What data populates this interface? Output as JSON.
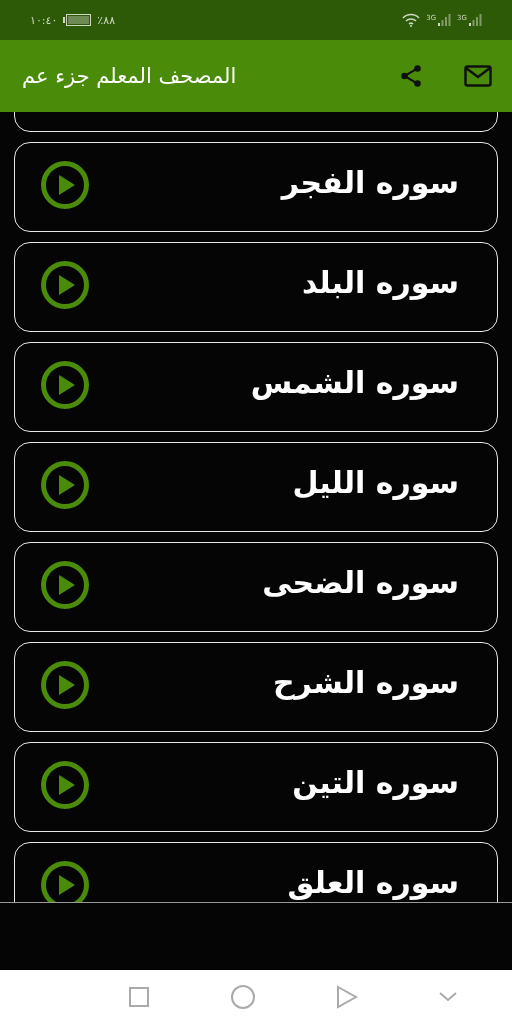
{
  "status_bar": {
    "time": "١٠:٤٠",
    "battery": "٪٨٨",
    "network_labels": [
      "3G",
      "3G"
    ]
  },
  "app_bar": {
    "title": "المصحف المعلم جزء عم"
  },
  "surahs": [
    {
      "name": "سوره الفجر"
    },
    {
      "name": "سوره البلد"
    },
    {
      "name": "سوره الشمس"
    },
    {
      "name": "سوره الليل"
    },
    {
      "name": "سوره الضحى"
    },
    {
      "name": "سوره الشرح"
    },
    {
      "name": "سوره التين"
    },
    {
      "name": "سوره العلق"
    }
  ]
}
